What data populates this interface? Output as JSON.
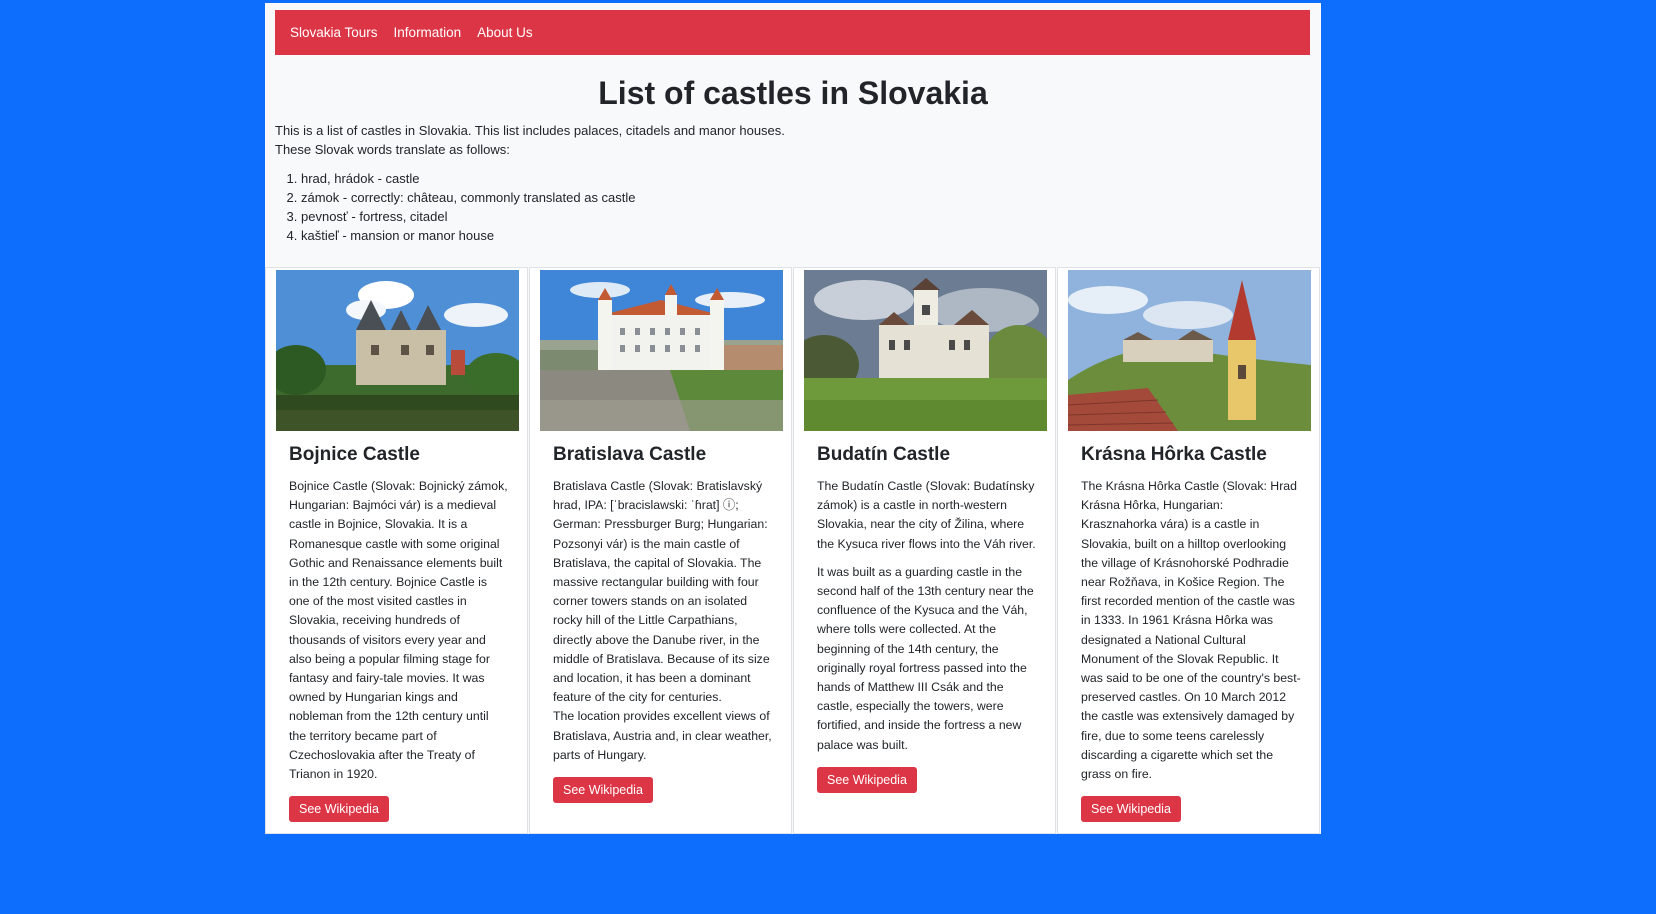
{
  "nav": {
    "brand": "Slovakia Tours",
    "items": [
      "Information",
      "About Us"
    ]
  },
  "page": {
    "title": "List of castles in Slovakia",
    "intro_line1": "This is a list of castles in Slovakia. This list includes palaces, citadels and manor houses.",
    "intro_line2": "These Slovak words translate as follows:",
    "terms": [
      "hrad, hrádok - castle",
      "zámok - correctly: château, commonly translated as castle",
      "pevnosť - fortress, citadel",
      "kaštieľ - mansion or manor house"
    ]
  },
  "cards": [
    {
      "title": "Bojnice Castle",
      "text1": "Bojnice Castle (Slovak: Bojnický zámok, Hungarian: Bajmóci vár) is a medieval castle in Bojnice, Slovakia. It is a Romanesque castle with some original Gothic and Renaissance elements built in the 12th century. Bojnice Castle is one of the most visited castles in Slovakia, receiving hundreds of thousands of visitors every year and also being a popular filming stage for fantasy and fairy-tale movies. It was owned by Hungarian kings and nobleman from the 12th century until the territory became part of Czechoslovakia after the Treaty of Trianon in 1920.",
      "text2": "",
      "button": "See Wikipedia"
    },
    {
      "title": "Bratislava Castle",
      "text1": "Bratislava Castle (Slovak: Bratislavský hrad, IPA: [ˈbracislawski: ˈɦrat] ⓘ; German: Pressburger Burg; Hungarian: Pozsonyi vár) is the main castle of Bratislava, the capital of Slovakia. The massive rectangular building with four corner towers stands on an isolated rocky hill of the Little Carpathians, directly above the Danube river, in the middle of Bratislava. Because of its size and location, it has been a dominant feature of the city for centuries.",
      "text2": "The location provides excellent views of Bratislava, Austria and, in clear weather, parts of Hungary.",
      "button": "See Wikipedia"
    },
    {
      "title": "Budatín Castle",
      "text1": "The Budatín Castle (Slovak: Budatínsky zámok) is a castle in north-western Slovakia, near the city of Žilina, where the Kysuca river flows into the Váh river.",
      "text2": "It was built as a guarding castle in the second half of the 13th century near the confluence of the Kysuca and the Váh, where tolls were collected. At the beginning of the 14th century, the originally royal fortress passed into the hands of Matthew III Csák and the castle, especially the towers, were fortified, and inside the fortress a new palace was built.",
      "button": "See Wikipedia"
    },
    {
      "title": "Krásna Hôrka Castle",
      "text1": "The Krásna Hôrka Castle (Slovak: Hrad Krásna Hôrka, Hungarian: Krasznahorka vára) is a castle in Slovakia, built on a hilltop overlooking the village of Krásnohorské Podhradie near Rožňava, in Košice Region. The first recorded mention of the castle was in 1333. In 1961 Krásna Hôrka was designated a National Cultural Monument of the Slovak Republic. It was said to be one of the country's best-preserved castles. On 10 March 2012 the castle was extensively damaged by fire, due to some teens carelessly discarding a cigarette which set the grass on fire.",
      "text2": "",
      "button": "See Wikipedia"
    }
  ],
  "colors": {
    "background": "#0d6efd",
    "navbar": "#dc3545",
    "container": "#f8f9fa",
    "button": "#dc3545"
  }
}
